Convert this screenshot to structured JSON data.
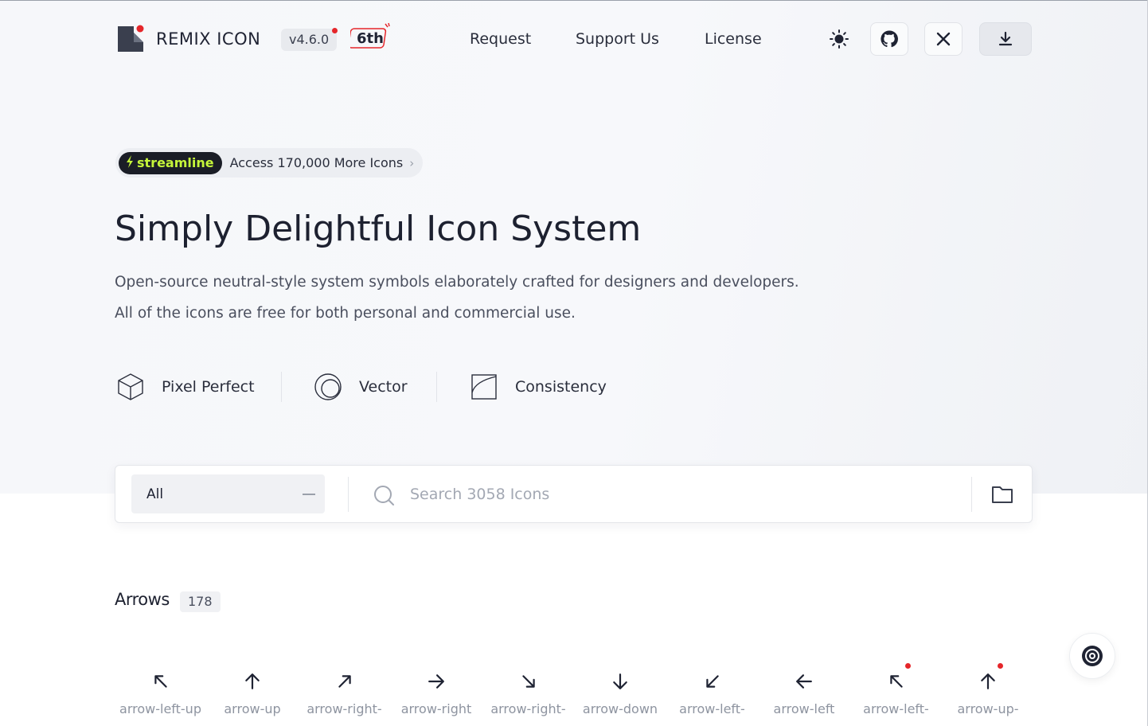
{
  "header": {
    "brand": "REMIX ICON",
    "version": "v4.6.0",
    "anniversary": "6th",
    "nav": [
      "Request",
      "Support Us",
      "License"
    ],
    "actions": [
      "sun-icon",
      "github-icon",
      "x-icon",
      "download-icon"
    ]
  },
  "promo": {
    "badge": "streamline",
    "text": "Access 170,000 More Icons"
  },
  "hero": {
    "title": "Simply Delightful Icon System",
    "line1": "Open-source neutral-style system symbols elaborately crafted for designers and developers.",
    "line2": "All of the icons are free for both personal and commercial use."
  },
  "features": [
    {
      "icon": "cube-icon",
      "label": "Pixel Perfect"
    },
    {
      "icon": "vector-circle-icon",
      "label": "Vector"
    },
    {
      "icon": "square-consistency-icon",
      "label": "Consistency"
    }
  ],
  "search": {
    "category": "All",
    "placeholder": "Search 3058 Icons"
  },
  "section": {
    "title": "Arrows",
    "count": "178"
  },
  "icons": [
    {
      "name": "arrow-left-up",
      "glyph": "left-up",
      "new": false
    },
    {
      "name": "arrow-up",
      "glyph": "up",
      "new": false
    },
    {
      "name": "arrow-right-",
      "glyph": "right-up",
      "new": false
    },
    {
      "name": "arrow-right",
      "glyph": "right",
      "new": false
    },
    {
      "name": "arrow-right-",
      "glyph": "right-down",
      "new": false
    },
    {
      "name": "arrow-down",
      "glyph": "down",
      "new": false
    },
    {
      "name": "arrow-left-",
      "glyph": "left-down",
      "new": false
    },
    {
      "name": "arrow-left",
      "glyph": "left",
      "new": false
    },
    {
      "name": "arrow-left-",
      "glyph": "left-up",
      "new": true
    },
    {
      "name": "arrow-up-",
      "glyph": "up",
      "new": true
    }
  ],
  "colors": {
    "accent_red": "#e5262a",
    "streamline_bg": "#1a1d26",
    "streamline_text": "#c5f53a",
    "text_primary": "#1f2333",
    "text_muted": "#8e94a0"
  }
}
